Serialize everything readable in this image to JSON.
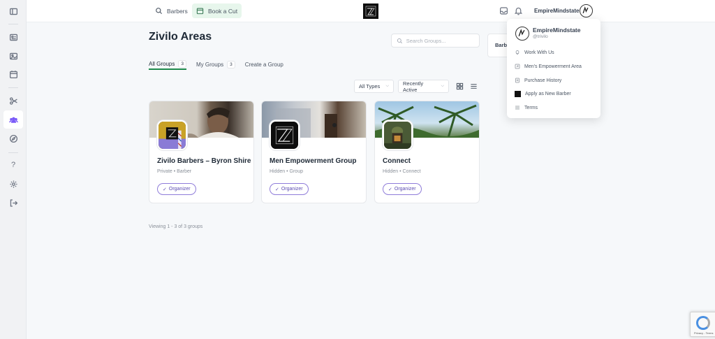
{
  "topbar": {
    "barbers_label": "Barbers",
    "book_label": "Book a Cut",
    "username": "EmpireMindstate"
  },
  "page": {
    "title": "Zivilo Areas",
    "search_placeholder": "Search Groups...",
    "side_card_label": "Barb"
  },
  "tabs": [
    {
      "label": "All Groups",
      "count": "3"
    },
    {
      "label": "My Groups",
      "count": "3"
    },
    {
      "label": "Create a Group"
    }
  ],
  "filters": {
    "type": "All Types",
    "order": "Recently Active"
  },
  "cards": [
    {
      "title": "Zivilo Barbers – Byron Shire",
      "meta": "Private • Barber",
      "badge": "Organizer"
    },
    {
      "title": "Men Empowerment Group",
      "meta": "Hidden • Group",
      "badge": "Organizer"
    },
    {
      "title": "Connect",
      "meta": "Hidden • Connect",
      "badge": "Organizer"
    }
  ],
  "viewing": "Viewing 1 - 3 of 3 groups",
  "dropdown": {
    "name": "EmpireMindstate",
    "handle": "@trivilo",
    "items": [
      {
        "label": "Work With Us",
        "icon": "lightbulb-icon"
      },
      {
        "label": "Men's Empowerment Area",
        "icon": "share-icon"
      },
      {
        "label": "Purchase History",
        "icon": "receipt-icon"
      },
      {
        "label": "Apply as New Barber",
        "icon": "logo-square-icon"
      },
      {
        "label": "Terms",
        "icon": "menu-icon"
      }
    ]
  },
  "recaptcha": {
    "text": "Privacy - Terms"
  },
  "colors": {
    "accent": "#1f8a4c",
    "organizer": "#8f7cd9",
    "active_sidebar": "#7a5af8"
  }
}
